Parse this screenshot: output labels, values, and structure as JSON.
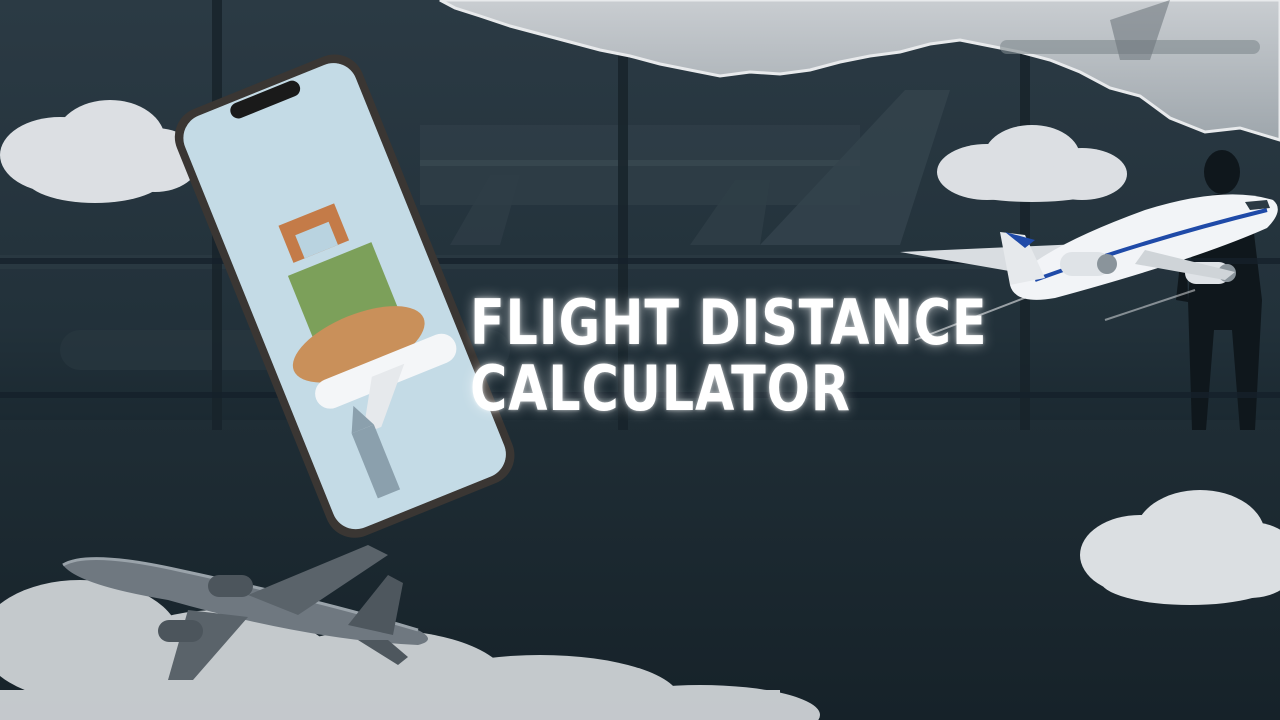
{
  "hero": {
    "title_line_1": "FLIGHT DISTANCE",
    "title_line_2": "CALCULATOR"
  },
  "colors": {
    "background": "#22313a",
    "title_text": "#ffffff",
    "cloud": "#e6e9ec",
    "phone_frame": "#3a3633",
    "phone_screen": "#cfe2ec",
    "plane_body": "#f2f4f7",
    "plane_stripe": "#1f4aa8"
  },
  "icons": [
    "phone-icon",
    "airplane-icon",
    "cloud-icon"
  ]
}
